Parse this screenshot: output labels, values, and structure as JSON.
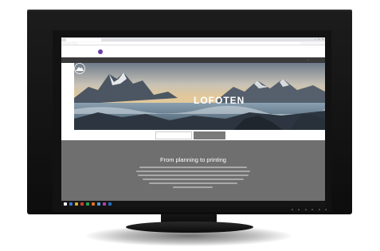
{
  "browser": {
    "tab_title": "",
    "url": ""
  },
  "site": {
    "logo": "",
    "top_nav": [
      "",
      "",
      "",
      "",
      "",
      ""
    ],
    "main_nav": [
      "",
      "",
      "",
      "",
      "",
      ""
    ]
  },
  "hero": {
    "title_small": "",
    "title": "LOFOTEN"
  },
  "section_tabs": {
    "tab_one": "",
    "tab_two": ""
  },
  "content": {
    "kicker": "",
    "title": "From planning to printing"
  },
  "taskbar": {
    "clock": "",
    "icon_colors": [
      "#ffffff",
      "#3a7bd5",
      "#e0b030",
      "#d04030",
      "#30a050",
      "#e07020",
      "#4aa0e0",
      "#b040b0",
      "#2070c0"
    ]
  },
  "colors": {
    "brand": "#6b3fa0",
    "content_bg": "#6f6f6f",
    "nav_bg": "#3a3a3a"
  }
}
